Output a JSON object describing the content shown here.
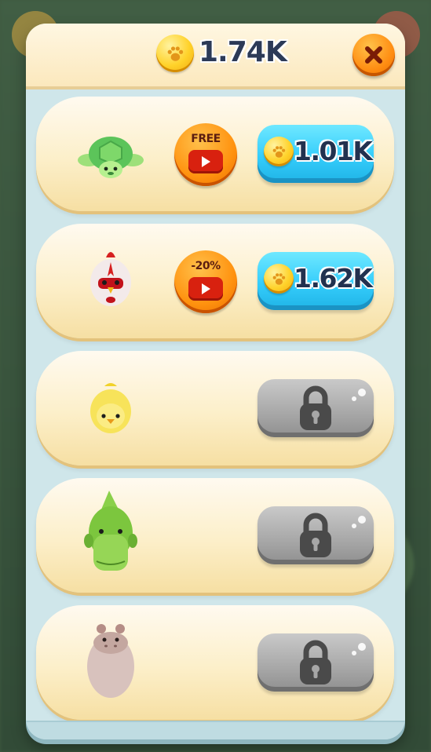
{
  "header": {
    "currency_icon": "paw-coin-icon",
    "balance": "1.74K",
    "close_icon": "close-x-icon"
  },
  "colors": {
    "cyan_button": "#35cdfb",
    "orange_button": "#ff920f",
    "locked_button": "#a7a7a7",
    "panel": "#cfe6ea",
    "row": "#fcefc9"
  },
  "rows": [
    {
      "animal": "turtle",
      "ad_label": "FREE",
      "status": "buyable",
      "price": "1.01K"
    },
    {
      "animal": "rooster",
      "ad_label": "-20%",
      "status": "buyable",
      "price": "1.62K"
    },
    {
      "animal": "chick",
      "status": "locked"
    },
    {
      "animal": "crocodile",
      "status": "locked"
    },
    {
      "animal": "hippo",
      "status": "locked"
    }
  ]
}
